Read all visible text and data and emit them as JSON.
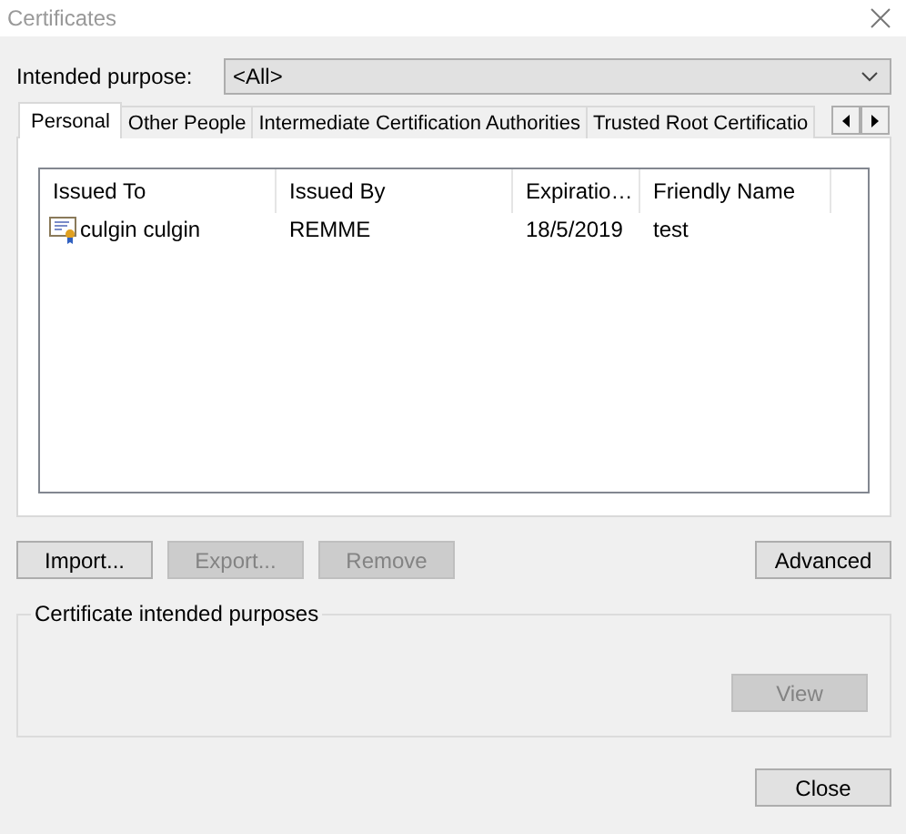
{
  "window": {
    "title": "Certificates"
  },
  "purpose": {
    "label": "Intended purpose:",
    "value": "<All>"
  },
  "tabs": [
    {
      "label": "Personal",
      "selected": true
    },
    {
      "label": "Other People",
      "selected": false
    },
    {
      "label": "Intermediate Certification Authorities",
      "selected": false
    },
    {
      "label": "Trusted Root Certificatio",
      "selected": false
    }
  ],
  "table": {
    "columns": [
      "Issued To",
      "Issued By",
      "Expiratio…",
      "Friendly Name"
    ],
    "rows": [
      {
        "cells": [
          "culgin culgin",
          "REMME",
          "18/5/2019",
          "test"
        ],
        "selected": false
      }
    ]
  },
  "buttons": [
    {
      "label": "Import...",
      "disabled": false
    },
    {
      "label": "Export...",
      "disabled": true
    },
    {
      "label": "Remove",
      "disabled": true
    }
  ],
  "advanced": {
    "label": "Advanced",
    "disabled": false
  },
  "purposes_group": {
    "title": "Certificate intended purposes",
    "view": {
      "label": "View",
      "disabled": true
    }
  },
  "close": {
    "label": "Close",
    "disabled": false
  }
}
